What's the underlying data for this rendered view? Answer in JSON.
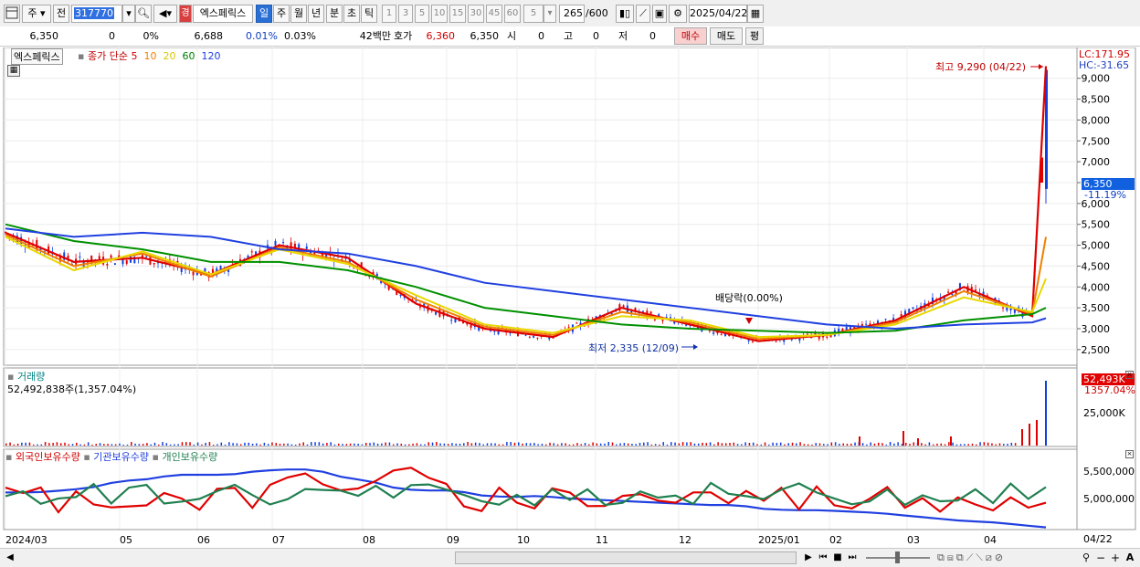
{
  "toolbar": {
    "icon_left": "chart-window-icon",
    "market": "주",
    "prev_label": "전",
    "code": "317770",
    "name": "엑스페릭스",
    "badge": "경",
    "periods": [
      "일",
      "주",
      "월",
      "년",
      "분",
      "초",
      "틱"
    ],
    "period_selected": "일",
    "intervals": [
      "1",
      "3",
      "5",
      "10",
      "15",
      "30",
      "45",
      "60"
    ],
    "interval_value": "5",
    "count": "265",
    "count_total": "/600",
    "date": "2025/04/22"
  },
  "info": {
    "price": "6,350",
    "change": "0",
    "change_pct": "0%",
    "prev_ref": "6,688",
    "r1": "0.01%",
    "r2": "0.03%",
    "amount": "42백만",
    "ask_label": "호가",
    "ask": "6,360",
    "bid": "6,350",
    "open_label": "시",
    "open": "0",
    "high_label": "고",
    "high": "0",
    "low_label": "저",
    "low": "0",
    "buy": "매수",
    "sell": "매도",
    "eval": "평"
  },
  "price_panel": {
    "name": "엑스페릭스",
    "ma_title": "종가 단순",
    "ma": [
      "5",
      "10",
      "20",
      "60",
      "120"
    ],
    "ma_colors": [
      "#e00000",
      "#f08000",
      "#e8d800",
      "#009000",
      "#2040e0"
    ],
    "lc": "LC:171.95",
    "hc": "HC:-31.65",
    "current": "6,350",
    "current_pct": "-11.19%",
    "high_note": "최고 9,290 (04/22)",
    "low_note": "최저 2,335 (12/09)",
    "div_note": "배당락(0.00%)",
    "y_ticks": [
      "9,000",
      "8,500",
      "8,000",
      "7,500",
      "7,000",
      "6,500",
      "6,000",
      "5,500",
      "5,000",
      "4,500",
      "4,000",
      "3,500",
      "3,000",
      "2,500"
    ]
  },
  "volume_panel": {
    "title": "거래량",
    "value": "52,492,838주(1,357.04%)",
    "badge": "52,493K",
    "badge_pct": "1357.04%",
    "tick": "25,000K"
  },
  "holding_panel": {
    "s1": "외국인보유수량",
    "s2": "기관보유수량",
    "s3": "개인보유수량",
    "colors": [
      "#e00000",
      "#2040e0",
      "#208050"
    ],
    "ticks": [
      "5,500,000",
      "5,000,000"
    ]
  },
  "x_axis": [
    "2024/03",
    "05",
    "06",
    "07",
    "08",
    "09",
    "10",
    "11",
    "12",
    "2025/01",
    "02",
    "03",
    "04"
  ],
  "x_last": "04/22",
  "chart_data": {
    "type": "line",
    "title": "엑스페릭스",
    "x": [
      "2024/03",
      "05",
      "06",
      "07",
      "08",
      "09",
      "10",
      "11",
      "12",
      "2025/01",
      "02",
      "03",
      "04",
      "04/22"
    ],
    "series": [
      {
        "name": "종가 단순 5",
        "values": [
          5300,
          4600,
          4700,
          4300,
          5000,
          4700,
          3600,
          3000,
          2800,
          3500,
          3100,
          2700,
          2850,
          3200,
          4000,
          3300,
          9290
        ]
      },
      {
        "name": "종가 단순 10",
        "values": [
          5250,
          4500,
          4800,
          4250,
          4950,
          4600,
          3700,
          3050,
          2850,
          3400,
          3150,
          2750,
          2850,
          3150,
          3900,
          3350,
          5200
        ]
      },
      {
        "name": "종가 단순 20",
        "values": [
          5200,
          4400,
          4850,
          4300,
          4900,
          4550,
          3800,
          3100,
          2900,
          3300,
          3200,
          2800,
          2850,
          3100,
          3750,
          3400,
          4200
        ]
      },
      {
        "name": "종가 단순 60",
        "values": [
          5500,
          5100,
          4900,
          4600,
          4600,
          4400,
          4000,
          3500,
          3300,
          3100,
          3000,
          2950,
          2900,
          2950,
          3200,
          3350,
          3500
        ]
      },
      {
        "name": "종가 단순 120",
        "values": [
          5400,
          5200,
          5300,
          5200,
          4900,
          4800,
          4500,
          4100,
          3900,
          3700,
          3500,
          3300,
          3100,
          3000,
          3100,
          3150,
          3250
        ]
      }
    ],
    "ylim": [
      2300,
      9300
    ],
    "high": {
      "value": 9290,
      "date": "04/22"
    },
    "low": {
      "value": 2335,
      "date": "12/09"
    }
  }
}
